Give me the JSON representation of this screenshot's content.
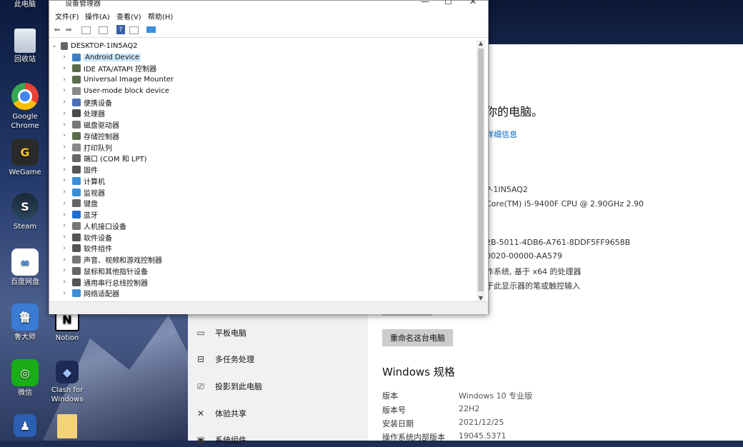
{
  "desktop": {
    "icons": [
      {
        "label": "此电脑"
      },
      {
        "label": "回收站"
      },
      {
        "label": "Google Chrome"
      },
      {
        "label": "WeGame"
      },
      {
        "label": "Steam"
      },
      {
        "label": "百度网盘"
      },
      {
        "label": "鲁大师"
      },
      {
        "label": "Notion"
      },
      {
        "label": "微信"
      },
      {
        "label": "Clash for Windows"
      }
    ]
  },
  "device_manager": {
    "title": "设备管理器",
    "menu": [
      "文件(F)",
      "操作(A)",
      "查看(V)",
      "帮助(H)"
    ],
    "root": "DESKTOP-1IN5AQ2",
    "items": [
      {
        "label": "Android Device",
        "color": "#3b7fc4"
      },
      {
        "label": "IDE ATA/ATAPI 控制器",
        "color": "#5a6b4a"
      },
      {
        "label": "Universal Image Mounter",
        "color": "#5a6b4a"
      },
      {
        "label": "User-mode block device",
        "color": "#888888"
      },
      {
        "label": "便携设备",
        "color": "#4a6fb5"
      },
      {
        "label": "处理器",
        "color": "#4a4a4a"
      },
      {
        "label": "磁盘驱动器",
        "color": "#777777"
      },
      {
        "label": "存储控制器",
        "color": "#5a6b4a"
      },
      {
        "label": "打印队列",
        "color": "#888888"
      },
      {
        "label": "端口 (COM 和 LPT)",
        "color": "#666666"
      },
      {
        "label": "固件",
        "color": "#555555"
      },
      {
        "label": "计算机",
        "color": "#3b8fd9"
      },
      {
        "label": "监视器",
        "color": "#3b8fd9"
      },
      {
        "label": "键盘",
        "color": "#666666"
      },
      {
        "label": "蓝牙",
        "color": "#1f6fd1"
      },
      {
        "label": "人机接口设备",
        "color": "#777777"
      },
      {
        "label": "软件设备",
        "color": "#555555"
      },
      {
        "label": "软件组件",
        "color": "#555555"
      },
      {
        "label": "声音、视频和游戏控制器",
        "color": "#777777"
      },
      {
        "label": "鼠标和其他指针设备",
        "color": "#666666"
      },
      {
        "label": "通用串行总线控制器",
        "color": "#555555"
      },
      {
        "label": "网络适配器",
        "color": "#3b8fd9"
      }
    ]
  },
  "settings": {
    "heading_partial": "你的电脑。",
    "link_partial": "详细信息",
    "device_name_partial": "P-1IN5AQ2",
    "processor_partial": "Core(TM) i5-9400F CPU @ 2.90GHz   2.90",
    "device_id_partial": "2B-5011-4DB6-A761-8DDF5FF9658B",
    "product_id_partial": "0020-00000-AA579",
    "system_type_partial": "作系统, 基于 x64 的处理器",
    "pen_touch_partial": "于此显示器的笔或触控输入",
    "rename_button": "重命名这台电脑",
    "windows_spec_title": "Windows 规格",
    "spec_rows": [
      {
        "key": "版本",
        "value": "Windows 10 专业版"
      },
      {
        "key": "版本号",
        "value": "22H2"
      },
      {
        "key": "安装日期",
        "value": "2021/12/25"
      },
      {
        "key": "操作系统内部版本",
        "value": "19045.5371"
      }
    ],
    "nav": [
      {
        "label": "平板电脑",
        "icon": "tablet-icon"
      },
      {
        "label": "多任务处理",
        "icon": "multitask-icon"
      },
      {
        "label": "投影到此电脑",
        "icon": "project-icon"
      },
      {
        "label": "体验共享",
        "icon": "share-icon"
      },
      {
        "label": "系统组件",
        "icon": "components-icon"
      }
    ]
  }
}
